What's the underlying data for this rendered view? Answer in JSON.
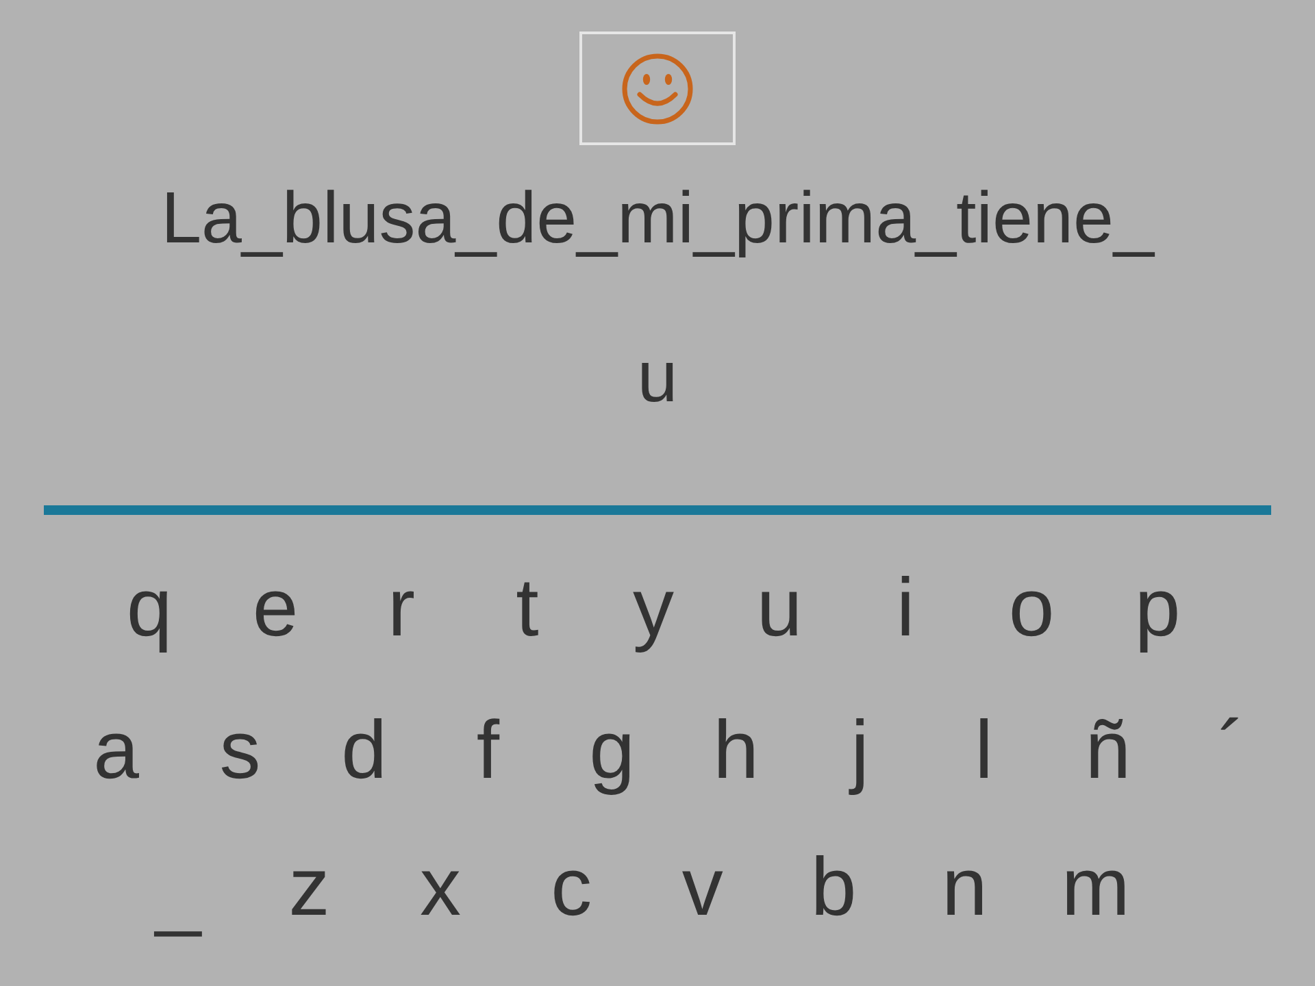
{
  "sentence": "La_blusa_de_mi_prima_tiene_",
  "answer": "u",
  "keyboard": {
    "rows": [
      [
        "q",
        "e",
        "r",
        "t",
        "y",
        "u",
        "i",
        "o",
        "p"
      ],
      [
        "a",
        "s",
        "d",
        "f",
        "g",
        "h",
        "j",
        "l",
        "ñ",
        "´"
      ],
      [
        "_",
        "z",
        "x",
        "c",
        "v",
        "b",
        "n",
        "m"
      ]
    ]
  }
}
